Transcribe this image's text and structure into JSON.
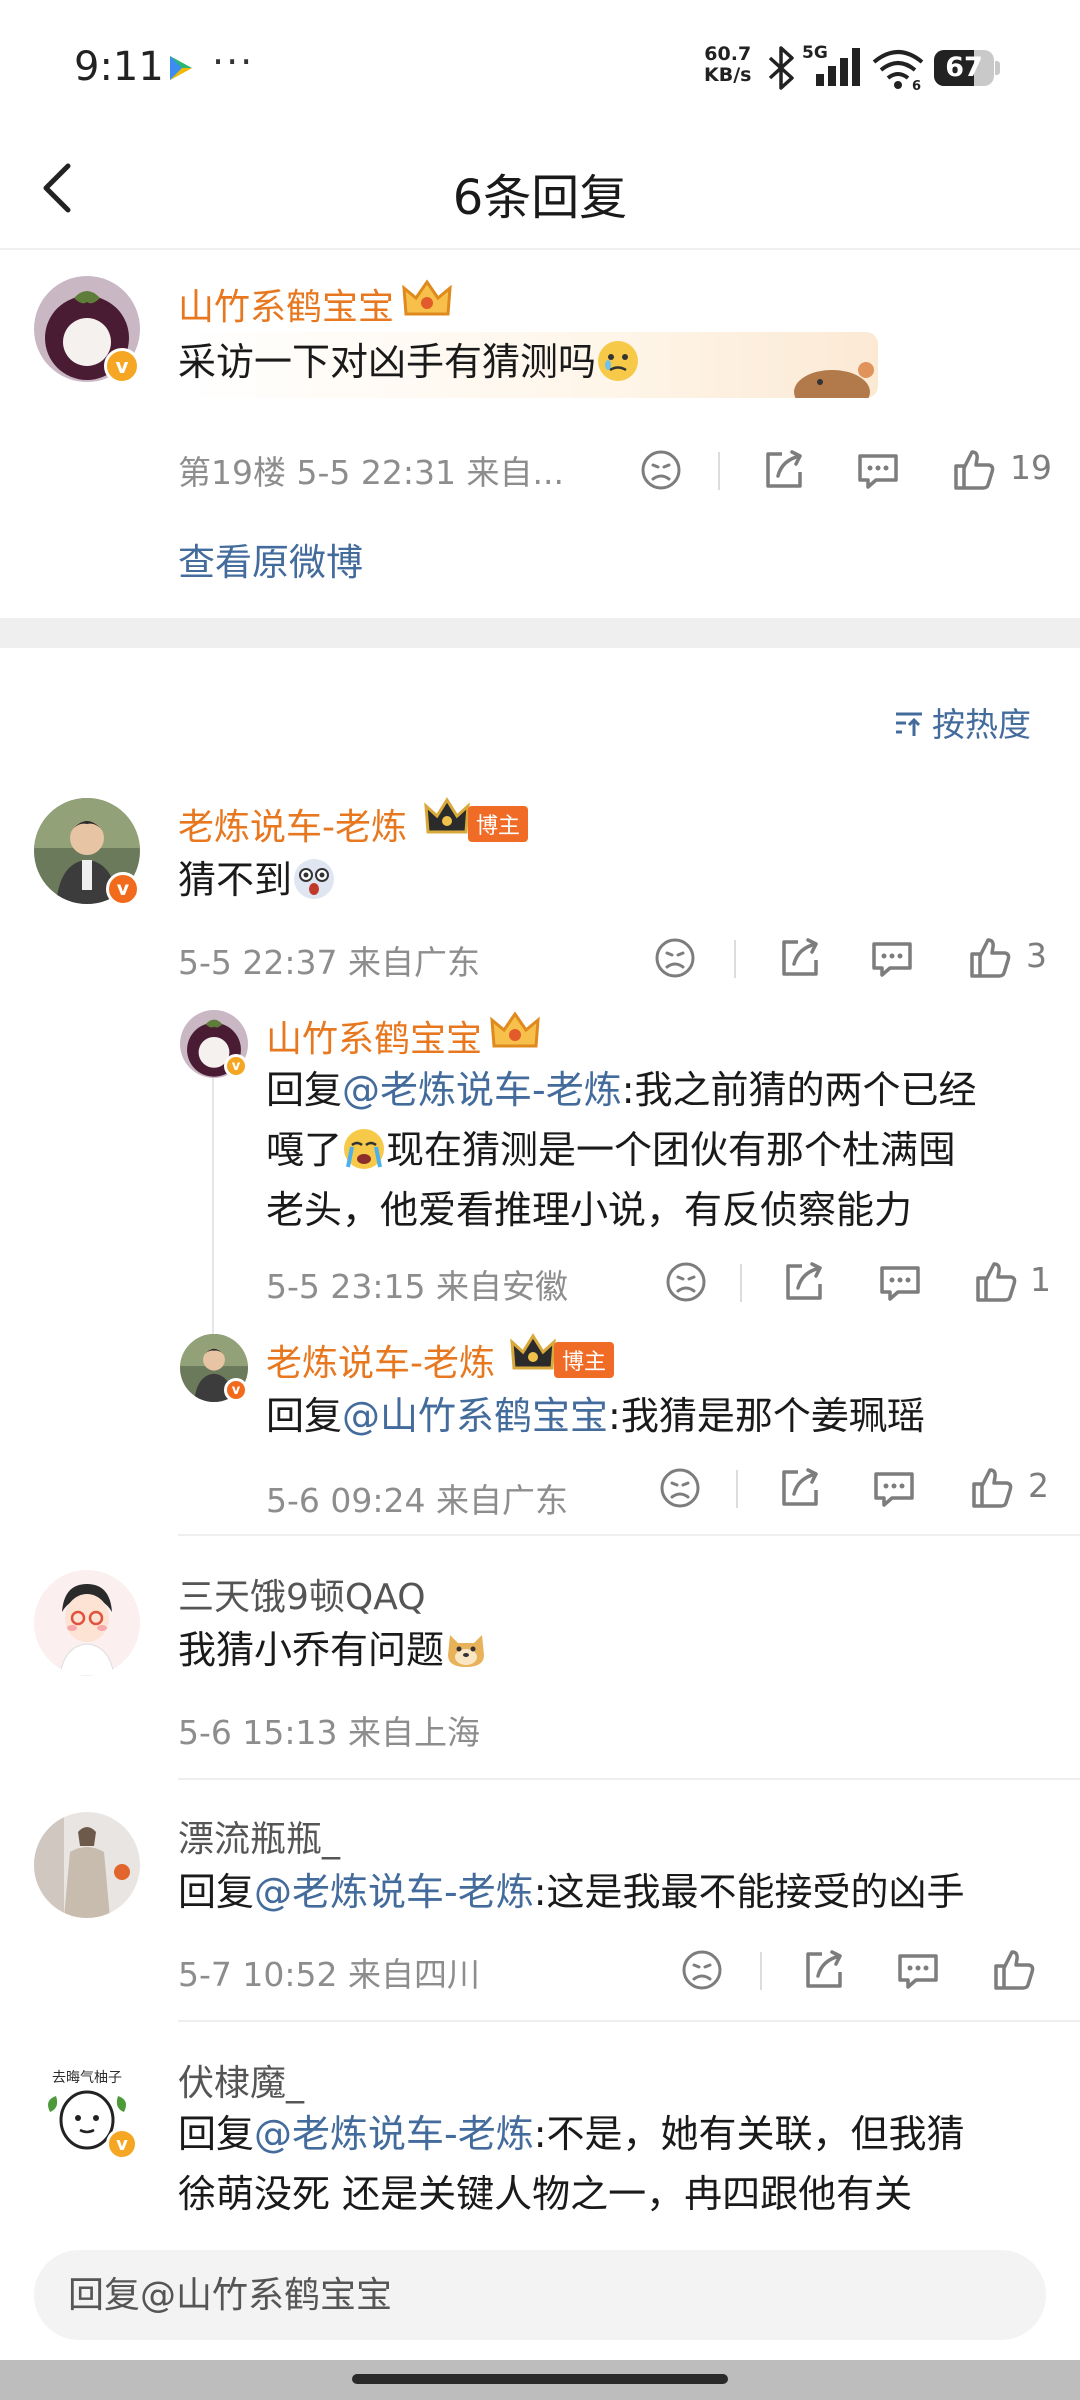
{
  "status_bar": {
    "time": "9:11",
    "net_speed_value": "60.7",
    "net_speed_unit": "KB/s",
    "network": "5G",
    "wifi_label": "6",
    "battery": "67",
    "battery_level": 0.67
  },
  "header": {
    "title": "6条回复"
  },
  "root_comment": {
    "username": "山竹系鹤宝宝",
    "text": "采访一下对凶手有猜测吗",
    "meta": "第19楼 5-5 22:31 来自...",
    "likes": "19",
    "view_original": "查看原微博"
  },
  "sort": {
    "label": "按热度"
  },
  "replies": [
    {
      "username": "老炼说车-老炼",
      "tag": "博主",
      "text": "猜不到",
      "meta": "5-5 22:37 来自广东",
      "likes": "3",
      "sub_replies": [
        {
          "username": "山竹系鹤宝宝",
          "prefix": "回复",
          "mention": "@老炼说车-老炼",
          "text_line1": ":我之前猜的两个已经",
          "text_line2": "嘎了",
          "text_line2b": "现在猜测是一个团伙有那个杜满囤",
          "text_line3": "老头，他爱看推理小说，有反侦察能力",
          "meta": "5-5 23:15 来自安徽",
          "likes": "1"
        },
        {
          "username": "老炼说车-老炼",
          "tag": "博主",
          "prefix": "回复",
          "mention": "@山竹系鹤宝宝",
          "text": ":我猜是那个姜珮瑶",
          "meta": "5-6 09:24 来自广东",
          "likes": "2"
        }
      ]
    },
    {
      "username": "三天饿9顿QAQ",
      "text": "我猜小乔有问题",
      "meta": "5-6 15:13 来自上海"
    },
    {
      "username": "漂流瓶瓶_",
      "prefix": "回复",
      "mention": "@老炼说车-老炼",
      "text": ":这是我最不能接受的凶手",
      "meta": "5-7 10:52 来自四川"
    },
    {
      "username": "伏棣魔_",
      "prefix": "回复",
      "mention": "@老炼说车-老炼",
      "text_line1": ":不是，她有关联，但我猜",
      "text_line2": "徐萌没死 还是关键人物之一，冉四跟他有关",
      "avatar_text": "去晦气柚子"
    }
  ],
  "reply_input": {
    "placeholder": "回复@山竹系鹤宝宝"
  },
  "icons": [
    "back-icon",
    "play-store-icon",
    "bluetooth-icon",
    "signal-icon",
    "wifi-icon",
    "battery-icon",
    "dislike-icon",
    "share-icon",
    "comment-icon",
    "like-icon",
    "sort-icon",
    "crown-icon",
    "verified-icon"
  ],
  "colors": {
    "accent_orange": "#e8781f",
    "link_blue": "#436b9c",
    "meta_gray": "#8d8d8d",
    "host_tag": "#f06b25"
  }
}
